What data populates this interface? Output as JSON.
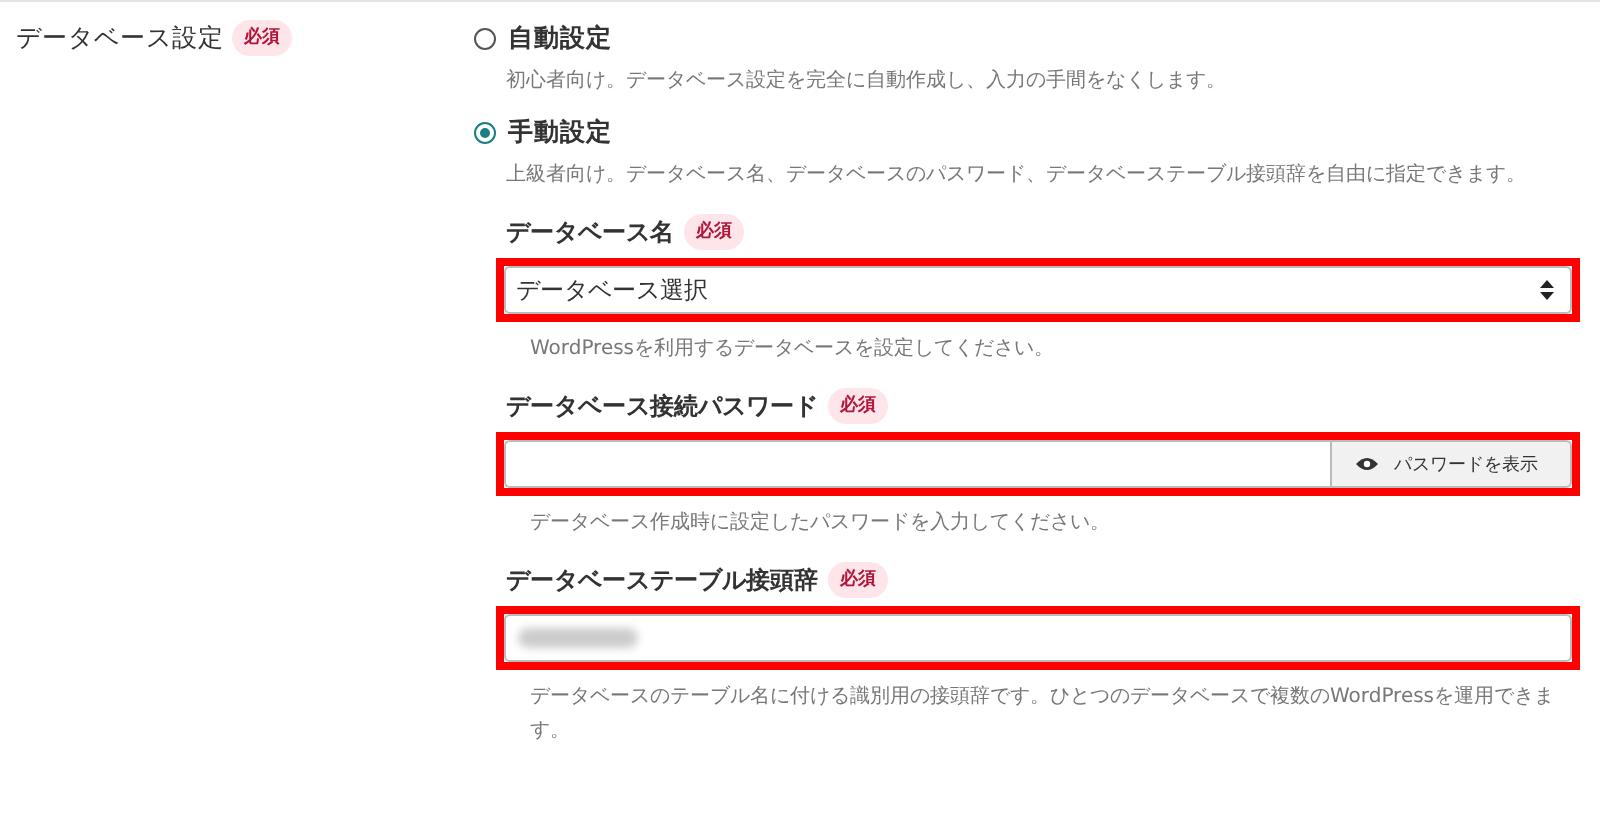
{
  "section": {
    "label": "データベース設定",
    "badge": "必須"
  },
  "options": [
    {
      "label": "自動設定",
      "selected": false,
      "description": "初心者向け。データベース設定を完全に自動作成し、入力の手間をなくします。"
    },
    {
      "label": "手動設定",
      "selected": true,
      "description": "上級者向け。データベース名、データベースのパスワード、データベーステーブル接頭辞を自由に指定できます。"
    }
  ],
  "fields": [
    {
      "kind": "select",
      "label": "データベース名",
      "badge": "必須",
      "value": "データベース選択",
      "highlighted": true,
      "help": "WordPressを利用するデータベースを設定してください。"
    },
    {
      "kind": "password",
      "label": "データベース接続パスワード",
      "badge": "必須",
      "button": "パスワードを表示",
      "highlighted": true,
      "help": "データベース作成時に設定したパスワードを入力してください。"
    },
    {
      "kind": "text",
      "label": "データベーステーブル接頭辞",
      "badge": "必須",
      "value_redacted": true,
      "highlighted": true,
      "help": "データベースのテーブル名に付ける識別用の接頭辞です。ひとつのデータベースで複数のWordPressを運用できます。"
    }
  ]
}
